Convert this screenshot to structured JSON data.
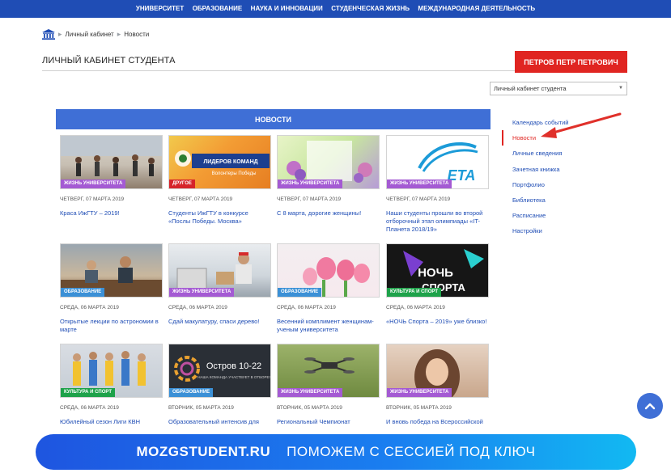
{
  "topnav": {
    "items": [
      "УНИВЕРСИТЕТ",
      "ОБРАЗОВАНИЕ",
      "НАУКА И ИННОВАЦИИ",
      "СТУДЕНЧЕСКАЯ ЖИЗНЬ",
      "МЕЖДУНАРОДНАЯ ДЕЯТЕЛЬНОСТЬ"
    ]
  },
  "breadcrumb": {
    "home_icon": "university-building-icon",
    "items": [
      "Личный кабинет",
      "Новости"
    ]
  },
  "page": {
    "title": "ЛИЧНЫЙ КАБИНЕТ СТУДЕНТА",
    "user_button": "ПЕТРОВ ПЕТР ПЕТРОВИЧ",
    "select_value": "Личный кабинет студента"
  },
  "news": {
    "header": "НОВОСТИ",
    "cards": [
      {
        "tag": "ЖИЗНЬ УНИВЕРСИТЕТА",
        "tag_color": "purple",
        "date": "ЧЕТВЕРГ, 07 МАРТА 2019",
        "title": "Краса ИжГТУ – 2019!"
      },
      {
        "tag": "ДРУГОЕ",
        "tag_color": "red",
        "date": "ЧЕТВЕРГ, 07 МАРТА 2019",
        "title": "Студенты ИжГТУ в конкурсе «Послы Победы. Москва»"
      },
      {
        "tag": "ЖИЗНЬ УНИВЕРСИТЕТА",
        "tag_color": "purple",
        "date": "ЧЕТВЕРГ, 07 МАРТА 2019",
        "title": "С 8 марта, дорогие женщины!"
      },
      {
        "tag": "ЖИЗНЬ УНИВЕРСИТЕТА",
        "tag_color": "purple",
        "date": "ЧЕТВЕРГ, 07 МАРТА 2019",
        "title": "Наши студенты прошли во второй отборочный этап олимпиады «IT-Планета 2018/19»"
      },
      {
        "tag": "ОБРАЗОВАНИЕ",
        "tag_color": "blue",
        "date": "СРЕДА, 06 МАРТА 2019",
        "title": "Открытые лекции по астрономии в марте"
      },
      {
        "tag": "ЖИЗНЬ УНИВЕРСИТЕТА",
        "tag_color": "purple",
        "date": "СРЕДА, 06 МАРТА 2019",
        "title": "Сдай макулатуру, спаси дерево!"
      },
      {
        "tag": "ОБРАЗОВАНИЕ",
        "tag_color": "blue",
        "date": "СРЕДА, 06 МАРТА 2019",
        "title": "Весенний комплимент женщинам-ученым университета"
      },
      {
        "tag": "КУЛЬТУРА И СПОРТ",
        "tag_color": "green",
        "date": "СРЕДА, 06 МАРТА 2019",
        "title": "«НОЧЬ Спорта – 2019» уже близко!"
      },
      {
        "tag": "КУЛЬТУРА И СПОРТ",
        "tag_color": "green",
        "date": "СРЕДА, 06 МАРТА 2019",
        "title": "Юбилейный сезон Лиги КВН"
      },
      {
        "tag": "ОБРАЗОВАНИЕ",
        "tag_color": "blue",
        "date": "ВТОРНИК, 05 МАРТА 2019",
        "title": "Образовательный интенсив для"
      },
      {
        "tag": "ЖИЗНЬ УНИВЕРСИТЕТА",
        "tag_color": "purple",
        "date": "ВТОРНИК, 05 МАРТА 2019",
        "title": "Региональный Чемпионат"
      },
      {
        "tag": "ЖИЗНЬ УНИВЕРСИТЕТА",
        "tag_color": "purple",
        "date": "ВТОРНИК, 05 МАРТА 2019",
        "title": "И вновь победа на Всероссийской"
      }
    ],
    "thumb_texts": {
      "leaders": "ЛИДЕРОВ КОМАНД",
      "volunteers": "Волонтеры Победы",
      "eta": "ETA",
      "night1": "НОЧЬ",
      "night2": "СПОРТА",
      "island": "Остров 10-22",
      "island_sub": "НАША КОМАНДА УЧАСТВУЕТ В ОТБОРЕ!"
    }
  },
  "side_menu": {
    "items": [
      "Календарь событий",
      "Новости",
      "Личные сведения",
      "Зачетная книжка",
      "Портфолио",
      "Библиотека",
      "Расписание",
      "Настройки"
    ],
    "active_index": 1
  },
  "banner": {
    "brand": "MOZGSTUDENT.RU",
    "slogan": "ПОМОЖЕМ С СЕССИЕЙ ПОД КЛЮЧ"
  },
  "colors": {
    "nav_blue": "#1f4db5",
    "accent_red": "#e02521",
    "news_blue": "#3f6fd6",
    "tag_purple": "#a45ad3",
    "tag_red": "#d6232a",
    "tag_blue": "#3b90d6",
    "tag_green": "#1ea24a"
  }
}
